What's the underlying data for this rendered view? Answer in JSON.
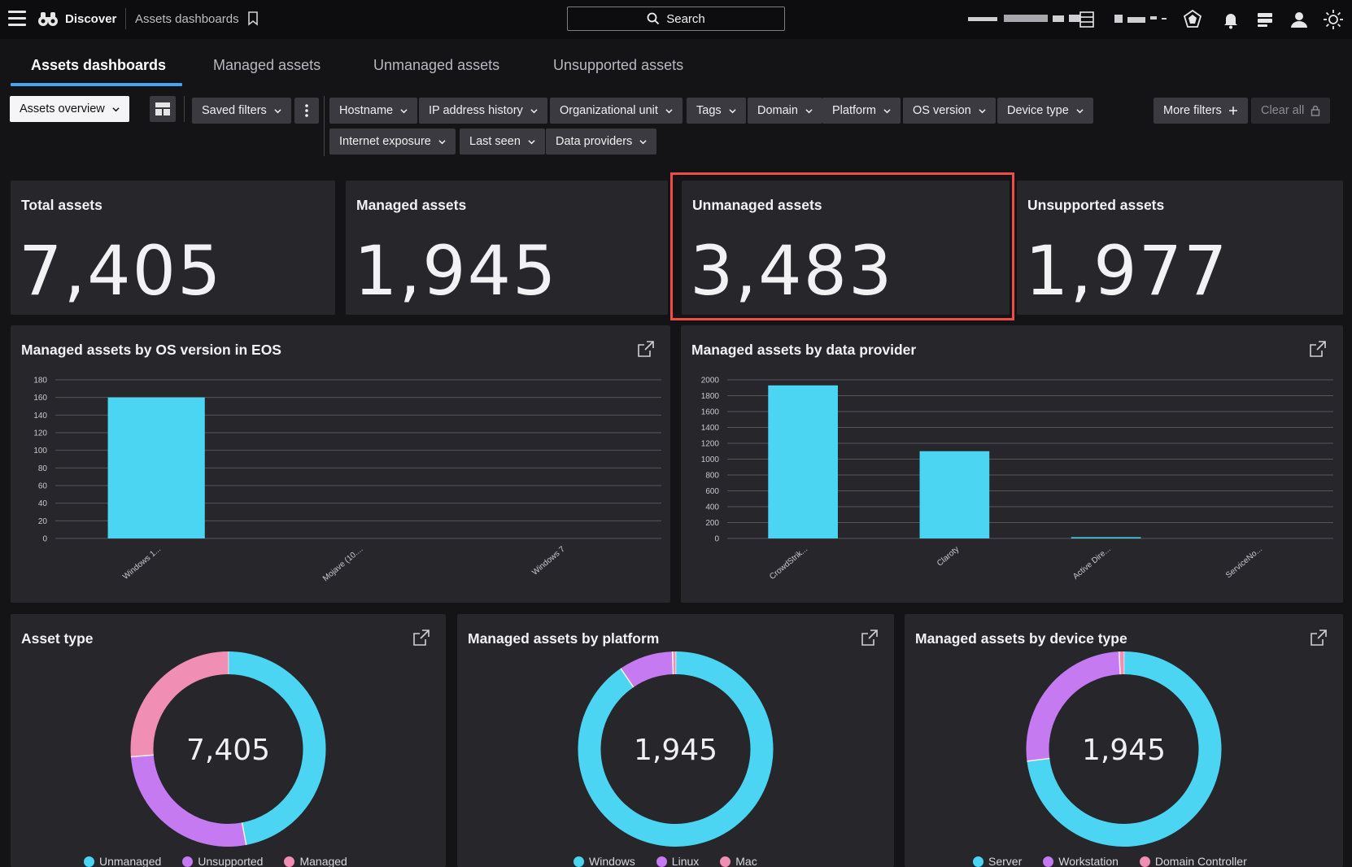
{
  "header": {
    "app_name": "Discover",
    "breadcrumb": "Assets dashboards",
    "search_label": "Search"
  },
  "tabs": [
    {
      "label": "Assets dashboards",
      "active": true
    },
    {
      "label": "Managed assets",
      "active": false
    },
    {
      "label": "Unmanaged assets",
      "active": false
    },
    {
      "label": "Unsupported assets",
      "active": false
    }
  ],
  "toolbar": {
    "view_select": "Assets overview",
    "saved_filters": "Saved filters",
    "more_filters": "More filters",
    "clear_all": "Clear all"
  },
  "filters": [
    "Hostname",
    "IP address history",
    "Organizational unit",
    "Tags",
    "Domain",
    "Platform",
    "OS version",
    "Device type",
    "Internet exposure",
    "Last seen",
    "Data providers"
  ],
  "stats": [
    {
      "label": "Total assets",
      "value": "7,405"
    },
    {
      "label": "Managed assets",
      "value": "1,945"
    },
    {
      "label": "Unmanaged assets",
      "value": "3,483"
    },
    {
      "label": "Unsupported assets",
      "value": "1,977"
    }
  ],
  "colors": {
    "cyan": "#4bd5f3",
    "purple": "#c57af2",
    "pink": "#f08fb3",
    "highlight": "#f04d46"
  },
  "chart_data": [
    {
      "type": "bar",
      "title": "Managed assets by OS version in EOS",
      "categories": [
        "Windows 1...",
        "Mojave (10....",
        "Windows 7"
      ],
      "values": [
        160,
        0,
        0
      ],
      "ylim": [
        0,
        180
      ],
      "yticks": [
        0,
        20,
        40,
        60,
        80,
        100,
        120,
        140,
        160,
        180
      ],
      "grid": true
    },
    {
      "type": "bar",
      "title": "Managed assets by data provider",
      "categories": [
        "CrowdStrik...",
        "Claroty",
        "Active Dire...",
        "ServiceNo..."
      ],
      "values": [
        1930,
        1100,
        5,
        0
      ],
      "ylim": [
        0,
        2000
      ],
      "yticks": [
        0,
        200,
        400,
        600,
        800,
        1000,
        1200,
        1400,
        1600,
        1800,
        2000
      ],
      "grid": true
    },
    {
      "type": "pie",
      "title": "Asset type",
      "center_label": "7,405",
      "labels": [
        "Unmanaged",
        "Unsupported",
        "Managed"
      ],
      "values": [
        3483,
        1977,
        1945
      ]
    },
    {
      "type": "pie",
      "title": "Managed assets by platform",
      "center_label": "1,945",
      "labels": [
        "Windows",
        "Linux",
        "Mac"
      ],
      "values": [
        1760,
        175,
        10
      ]
    },
    {
      "type": "pie",
      "title": "Managed assets by device type",
      "center_label": "1,945",
      "labels": [
        "Server",
        "Workstation",
        "Domain Controller"
      ],
      "values": [
        1420,
        510,
        15
      ]
    }
  ]
}
